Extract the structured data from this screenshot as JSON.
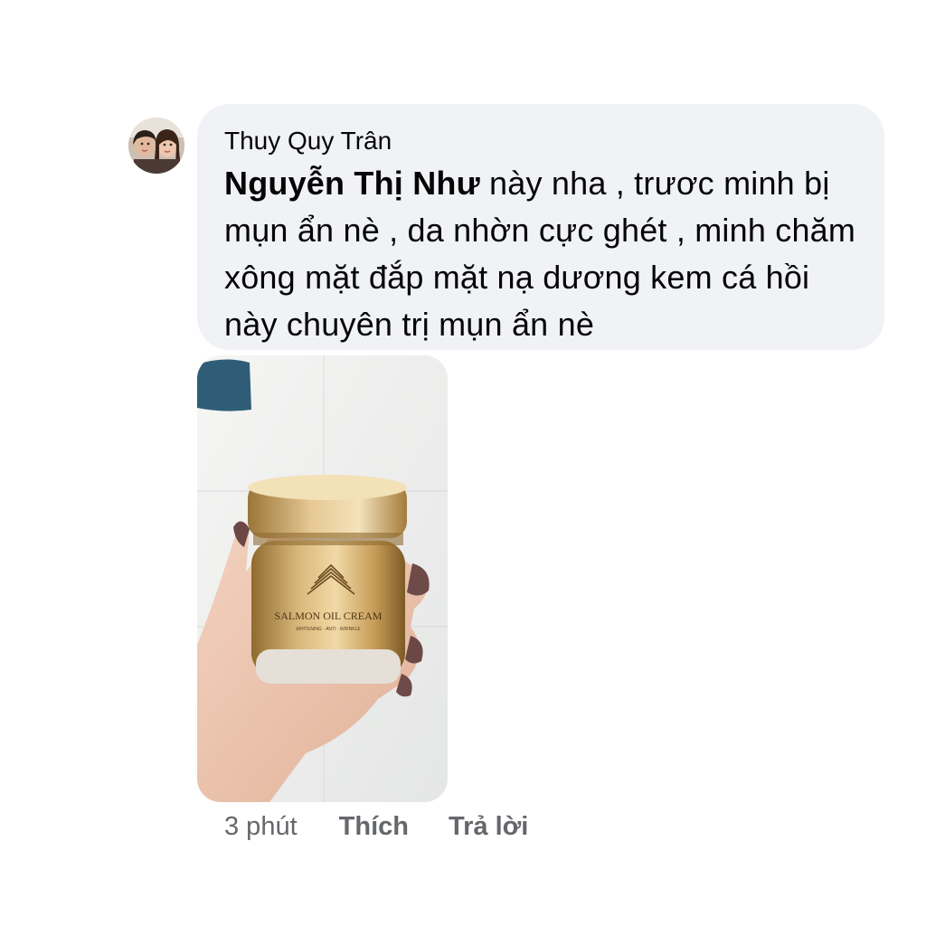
{
  "comment": {
    "author": "Thuy Quy Trân",
    "mention": "Nguyễn Thị Như",
    "text": " này nha , trươc minh bị mụn ẩn nè , da nhờn cực ghét , minh chăm xông mặt đắp mặt nạ dương kem cá hồi này chuyên trị mụn ẩn nè",
    "photo_product_label": "SALMON OIL CREAM",
    "photo_product_sublabel": "WHITENING · ANTI · WRINKLE"
  },
  "actions": {
    "time": "3 phút",
    "like_label": "Thích",
    "reply_label": "Trả lời"
  },
  "colors": {
    "bubble_bg": "#f0f2f5",
    "text": "#050505",
    "meta_text": "#65676b"
  },
  "icons": {
    "avatar": "profile-photo",
    "photo": "product-photo"
  }
}
